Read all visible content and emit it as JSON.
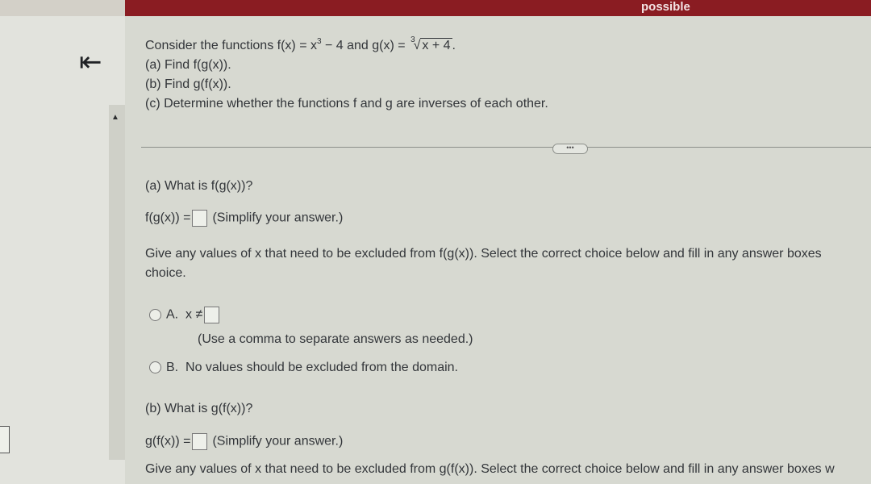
{
  "top": {
    "possible": "possible"
  },
  "question": {
    "intro": "Consider the functions f(x) = x",
    "intro_exp": "3",
    "intro_mid": " − 4 and g(x) = ",
    "root_index": "3",
    "radicand": "x + 4",
    "intro_end": ".",
    "part_a": "(a) Find f(g(x)).",
    "part_b": "(b) Find g(f(x)).",
    "part_c": "(c) Determine whether the functions f and g are inverses of each other."
  },
  "a": {
    "header": "(a) What is f(g(x))?",
    "lhs": "f(g(x)) =",
    "hint": "(Simplify your answer.)",
    "exclude_text": "Give any values of x that need to be excluded from f(g(x)). Select the correct choice below and fill in any answer boxes",
    "exclude_text2": "choice.",
    "choice_a_label": "A.",
    "choice_a_expr": "x ≠",
    "choice_a_hint": "(Use a comma to separate answers as needed.)",
    "choice_b_label": "B.",
    "choice_b_text": "No values should be excluded from the domain."
  },
  "b": {
    "header": "(b) What is g(f(x))?",
    "lhs": "g(f(x)) =",
    "hint": "(Simplify your answer.)",
    "exclude_text": "Give any values of x that need to be excluded from g(f(x)). Select the correct choice below and fill in any answer boxes w"
  },
  "icons": {
    "back": "back-to-start-icon",
    "collapse": "triangle-up-icon",
    "more": "ellipsis-icon"
  }
}
